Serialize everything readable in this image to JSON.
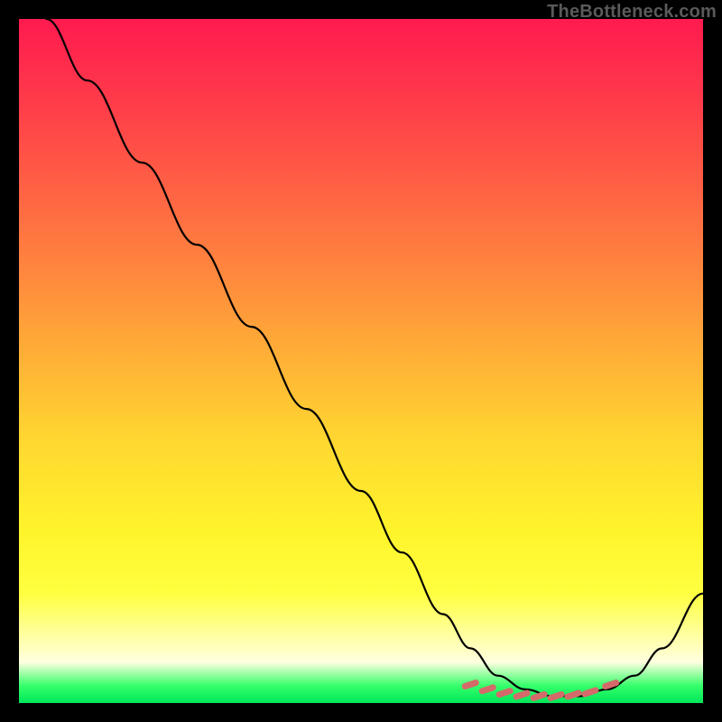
{
  "watermark": "TheBottleneck.com",
  "chart_data": {
    "type": "line",
    "title": "",
    "xlabel": "",
    "ylabel": "",
    "xlim": [
      0,
      100
    ],
    "ylim": [
      0,
      100
    ],
    "series": [
      {
        "name": "curve",
        "x": [
          4,
          10,
          18,
          26,
          34,
          42,
          50,
          56,
          62,
          66,
          70,
          74,
          78,
          82,
          86,
          90,
          94,
          100
        ],
        "values": [
          100,
          91,
          79,
          67,
          55,
          43,
          31,
          22,
          13,
          8,
          4,
          2,
          1,
          1,
          2,
          4,
          8,
          16
        ]
      }
    ],
    "markers": {
      "name": "highlight-dots",
      "color": "#d46a6a",
      "x": [
        66,
        68.5,
        71,
        73.5,
        76,
        78.5,
        81,
        83.5,
        86.5
      ],
      "values": [
        2.7,
        2.0,
        1.5,
        1.2,
        1.0,
        1.0,
        1.2,
        1.6,
        2.7
      ]
    }
  }
}
